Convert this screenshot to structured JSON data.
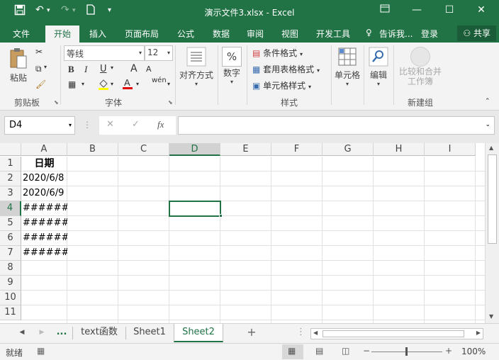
{
  "title_bar": {
    "title": "演示文件3.xlsx - Excel",
    "save_icon": "save-icon",
    "undo_icon": "undo-icon",
    "redo_icon": "redo-icon",
    "new_icon": "new-file-icon",
    "customize": "▾",
    "restore_icon": "ribbon-display-icon",
    "minimize": "—",
    "maximize": "☐",
    "close": "✕"
  },
  "ribbon_tabs": [
    "文件",
    "开始",
    "插入",
    "页面布局",
    "公式",
    "数据",
    "审阅",
    "视图",
    "开发工具"
  ],
  "tell_me": "告诉我...",
  "sign_in": "登录",
  "share": "共享",
  "clipboard": {
    "paste": "粘贴",
    "label": "剪贴板"
  },
  "font": {
    "name": "等线",
    "size": "12",
    "label": "字体",
    "bold": "B",
    "italic": "I",
    "underline": "U",
    "grow": "A",
    "shrink": "A",
    "wen": "wén"
  },
  "alignment": {
    "label": "对齐方式"
  },
  "number": {
    "label": "数字",
    "symbol": "%"
  },
  "styles": {
    "conditional": "条件格式",
    "table": "套用表格格式",
    "cell": "单元格样式",
    "label": "样式"
  },
  "cells": {
    "label": "单元格"
  },
  "editing": {
    "label": "编辑"
  },
  "newgroup": {
    "button": "比较和合并工作簿",
    "label": "新建组"
  },
  "formula_bar": {
    "name_box": "D4",
    "cancel": "✕",
    "enter": "✓",
    "fx": "fx",
    "value": ""
  },
  "columns": [
    "A",
    "B",
    "C",
    "D",
    "E",
    "F",
    "G",
    "H",
    "I"
  ],
  "rows": [
    "1",
    "2",
    "3",
    "4",
    "5",
    "6",
    "7",
    "8",
    "9",
    "10",
    "11"
  ],
  "cells_data": {
    "A1": "日期",
    "A2": "2020/6/8",
    "A3": "2020/6/9",
    "A4": "######",
    "A5": "######",
    "A6": "######",
    "A7": "######"
  },
  "selected_cell": "D4",
  "sheets": [
    "...",
    "text函数",
    "Sheet1",
    "Sheet2"
  ],
  "active_sheet": "Sheet2",
  "add_sheet": "+",
  "status": {
    "ready": "就绪",
    "zoom": "100%"
  },
  "accent": "#217346"
}
